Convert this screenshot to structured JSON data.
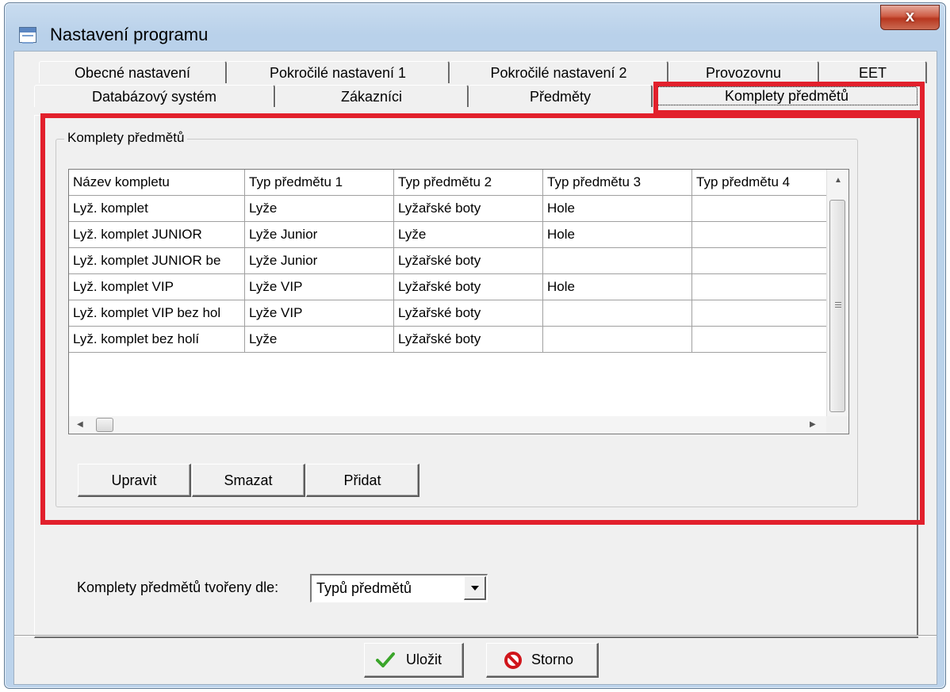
{
  "window": {
    "title": "Nastavení programu",
    "close_label": "x"
  },
  "tabs_row1": [
    "Obecné nastavení",
    "Pokročilé nastavení 1",
    "Pokročilé nastavení 2",
    "Provozovnu",
    "EET"
  ],
  "tabs_row2": [
    "Databázový systém",
    "Zákazníci",
    "Předměty",
    "Komplety předmětů"
  ],
  "group": {
    "title": "Komplety předmětů"
  },
  "grid": {
    "columns": [
      "Název kompletu",
      "Typ předmětu 1",
      "Typ předmětu 2",
      "Typ předmětu 3",
      "Typ předmětu 4"
    ],
    "rows": [
      [
        "Lyž. komplet",
        "Lyže",
        "Lyžařské boty",
        "Hole",
        ""
      ],
      [
        "Lyž. komplet JUNIOR",
        "Lyže Junior",
        "Lyže",
        "Hole",
        ""
      ],
      [
        "Lyž. komplet JUNIOR be",
        "Lyže Junior",
        "Lyžařské boty",
        "",
        ""
      ],
      [
        "Lyž. komplet VIP",
        "Lyže VIP",
        "Lyžařské boty",
        "Hole",
        ""
      ],
      [
        "Lyž. komplet VIP bez hol",
        "Lyže VIP",
        "Lyžařské boty",
        "",
        ""
      ],
      [
        "Lyž. komplet bez holí",
        "Lyže",
        "Lyžařské boty",
        "",
        ""
      ]
    ]
  },
  "actions": {
    "edit": "Upravit",
    "delete": "Smazat",
    "add": "Přidat"
  },
  "mode": {
    "label": "Komplety předmětů tvořeny dle:",
    "value": "Typů předmětů"
  },
  "footer": {
    "save": "Uložit",
    "cancel": "Storno"
  },
  "colors": {
    "highlight": "#e2202c",
    "check": "#3aa52a",
    "stop": "#d0151b"
  }
}
